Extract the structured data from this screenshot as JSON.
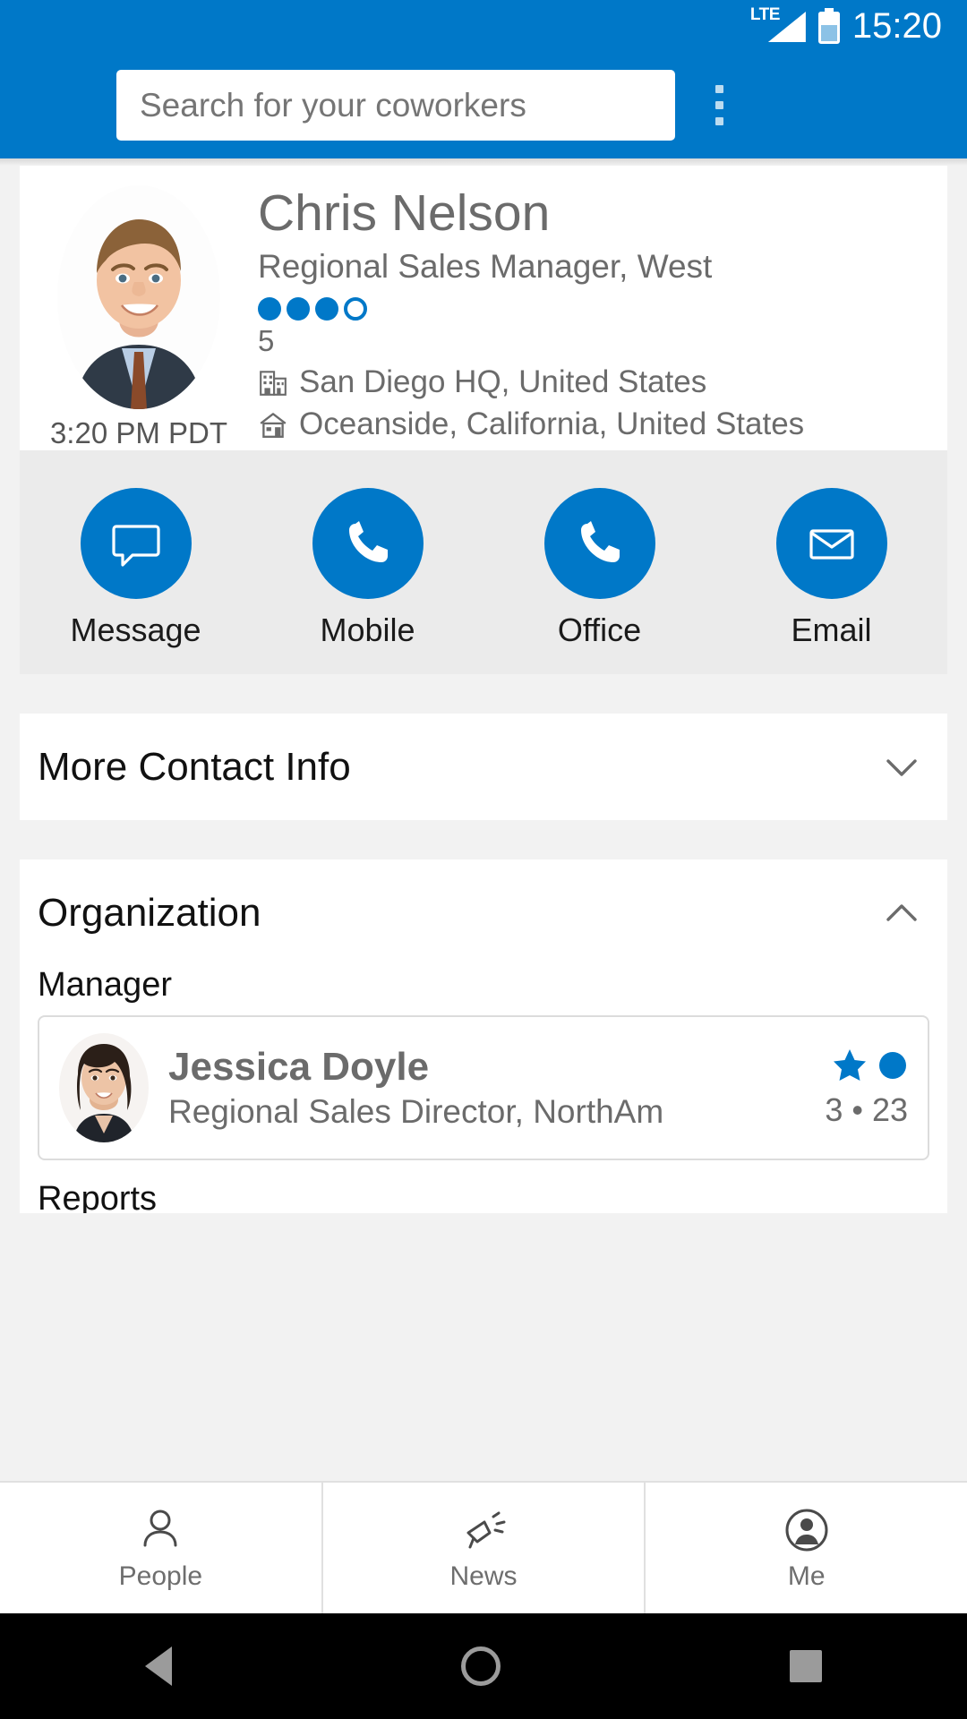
{
  "theme": {
    "brand": "#0078c8",
    "panel_bg": "#ebebeb",
    "page_bg": "#f2f2f2",
    "text_gray": "#6b6b6b"
  },
  "status_bar": {
    "network": "LTE",
    "time": "15:20",
    "battery_icon": "battery-icon",
    "signal_icon": "signal-icon"
  },
  "app_bar": {
    "search_placeholder": "Search for your coworkers",
    "search_value": "",
    "overflow_icon": "overflow-menu-icon"
  },
  "profile": {
    "name": "Chris Nelson",
    "title": "Regional Sales Manager, West",
    "local_time": "3:20 PM PDT",
    "level_filled": 3,
    "level_total": 4,
    "level_number": "5",
    "office_icon": "office-building-icon",
    "office": "San Diego HQ, United States",
    "home_icon": "home-icon",
    "home": "Oceanside, California, United States",
    "avatar_icon": "avatar-photo"
  },
  "actions": [
    {
      "label": "Message",
      "icon": "message-bubble-icon"
    },
    {
      "label": "Mobile",
      "icon": "phone-icon"
    },
    {
      "label": "Office",
      "icon": "phone-icon"
    },
    {
      "label": "Email",
      "icon": "envelope-icon"
    }
  ],
  "sections": {
    "more_contact": {
      "title": "More Contact Info",
      "expanded": false,
      "chevron": "chevron-down-icon"
    },
    "organization": {
      "title": "Organization",
      "expanded": true,
      "chevron": "chevron-up-icon",
      "manager_label": "Manager",
      "manager": {
        "name": "Jessica Doyle",
        "title": "Regional Sales Director, NorthAm",
        "star_icon": "star-icon",
        "circle_icon": "circle-icon",
        "counts": "3 • 23",
        "avatar_icon": "avatar-photo"
      },
      "reports_label": "Reports"
    }
  },
  "bottom_nav": [
    {
      "label": "People",
      "icon": "person-outline-icon",
      "selected": true
    },
    {
      "label": "News",
      "icon": "megaphone-icon",
      "selected": false
    },
    {
      "label": "Me",
      "icon": "account-circle-icon",
      "selected": false
    }
  ],
  "android_nav": [
    {
      "name": "back-button",
      "icon": "triangle-back-icon"
    },
    {
      "name": "home-button",
      "icon": "circle-home-icon"
    },
    {
      "name": "recents-button",
      "icon": "square-recents-icon"
    }
  ]
}
